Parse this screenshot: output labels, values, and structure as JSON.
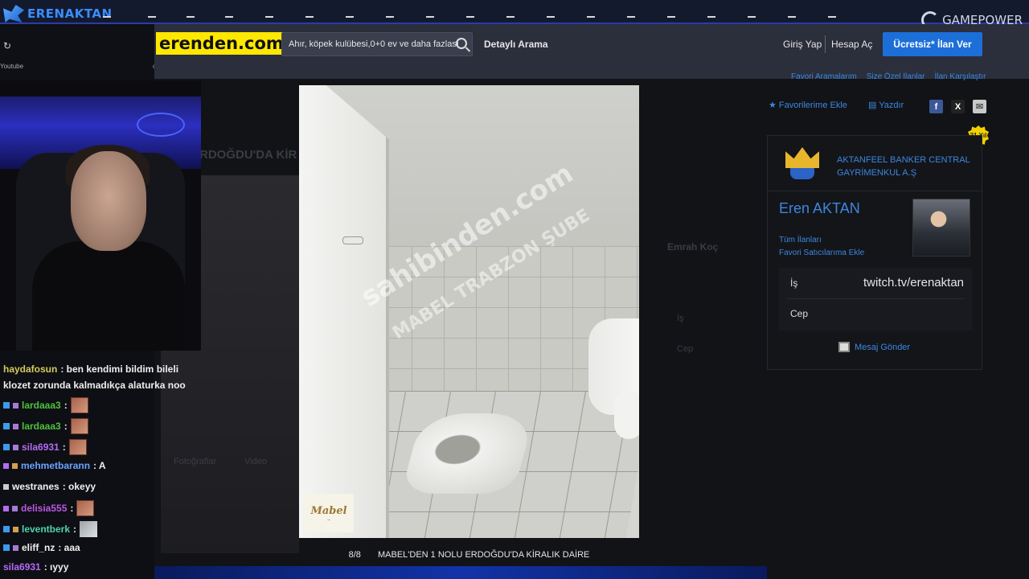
{
  "overlay": {
    "brand": "ERENAKTAN",
    "gamepower": "GAMEPOWER",
    "bookmark_youtube": "Youtube",
    "bookmark_ck": "ck"
  },
  "header": {
    "logo": "erenden.com",
    "search_placeholder": "Ahır, köpek kulübesi,0+0 ev ve daha fazlası",
    "advanced_search": "Detaylı Arama",
    "login": "Giriş Yap",
    "register": "Hesap Aç",
    "free_ad_button": "Ücretsiz* İlan Ver"
  },
  "background_page": {
    "title_fragment": "RDOĞDU'DA KİR",
    "seller_name": "Emrah Koç",
    "is_label": "İş",
    "cep_label": "Cep",
    "photos_tab": "Fotoğraflar",
    "video_tab": "Video"
  },
  "right_panel": {
    "links": [
      "Favori Aramalarım",
      "Size Özel İlanlar",
      "İlan Karşılaştır"
    ],
    "add_favorite": "Favorilerime Ekle",
    "print": "Yazdır",
    "years_badge": "31 Yıl",
    "company": "AKTANFEEL BANKER CENTRAL GAYRİMENKUL A.Ş",
    "agent_name": "Eren AKTAN",
    "all_ads": "Tüm İlanları",
    "favorite_sellers": "Favori Satıcılarıma Ekle",
    "is_label": "İş",
    "is_value": "twitch.tv/erenaktan",
    "cep_label": "Cep",
    "send_message": "Mesaj Gönder"
  },
  "lightbox": {
    "watermark_main": "sahibinden.com",
    "watermark_branch": "MABEL TRABZON ŞUBE",
    "office_logo": "Mabel",
    "counter": "8/8",
    "caption": "MABEL'DEN 1 NOLU ERDOĞDU'DA KİRALIK DAİRE"
  },
  "chat": [
    {
      "user": "haydafosun",
      "text": ": ben kendimi bildim bileli",
      "color": "#d3cb5a"
    },
    {
      "user": "",
      "text": "klozet zorunda kalmadıkça alaturka noo",
      "color": "#f0f0f0"
    },
    {
      "user": "lardaaa3",
      "text": ":",
      "color": "#4ec23d"
    },
    {
      "user": "lardaaa3",
      "text": ":",
      "color": "#4ec23d"
    },
    {
      "user": "sila6931",
      "text": ":",
      "color": "#b46bf4"
    },
    {
      "user": "mehmetbarann",
      "text": ": A",
      "color": "#6ba3ff"
    },
    {
      "user": "westranes",
      "text": ": okeyy",
      "color": "#f0f0f0"
    },
    {
      "user": "delisia555",
      "text": ":",
      "color": "#ba56e3"
    },
    {
      "user": "leventberk",
      "text": ":",
      "color": "#4fd3a8"
    },
    {
      "user": "eliff_nz",
      "text": ": aaa",
      "color": "#f0f0f0"
    },
    {
      "user": "sila6931",
      "text": ": ıyyy",
      "color": "#b46bf4"
    }
  ]
}
